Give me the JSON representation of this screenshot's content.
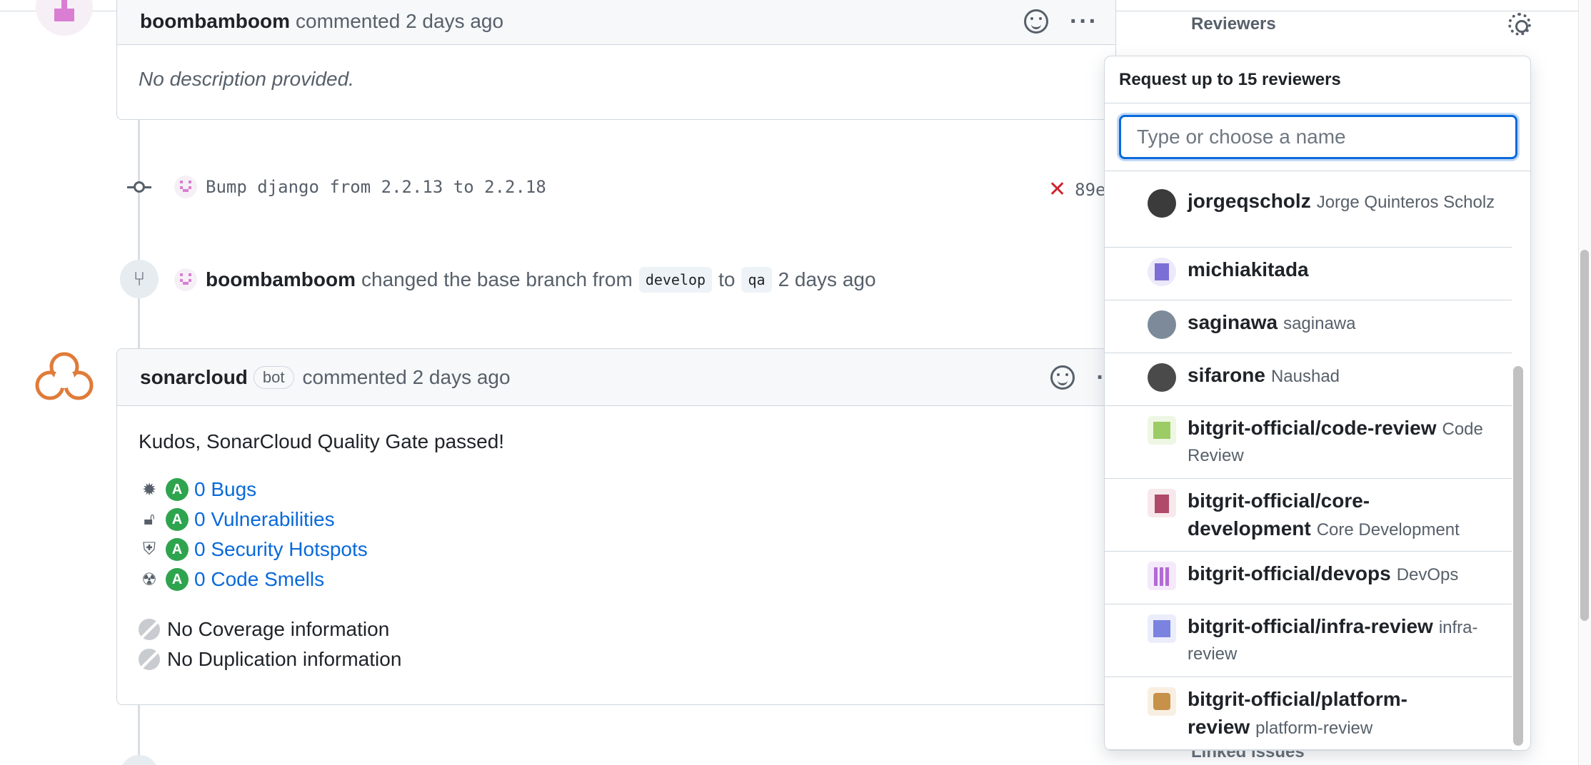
{
  "comment1": {
    "author": "boombamboom",
    "action": "commented 2 days ago",
    "body": "No description provided."
  },
  "commit": {
    "message": "Bump django from 2.2.13 to 2.2.18",
    "sha": "89e",
    "status_icon": "x-icon"
  },
  "base_change": {
    "author": "boombamboom",
    "text": "changed the base branch from",
    "from": "develop",
    "to_word": "to",
    "to": "qa",
    "time": "2 days ago"
  },
  "comment2": {
    "author": "sonarcloud",
    "badge": "bot",
    "action": "commented 2 days ago",
    "kudos": "Kudos, SonarCloud Quality Gate passed!",
    "metrics": [
      {
        "icon": "bug-icon",
        "grade": "A",
        "label": "0 Bugs"
      },
      {
        "icon": "unlock-icon",
        "grade": "A",
        "label": "0 Vulnerabilities"
      },
      {
        "icon": "shield-icon",
        "grade": "A",
        "label": "0 Security Hotspots"
      },
      {
        "icon": "radiation-icon",
        "grade": "A",
        "label": "0 Code Smells"
      }
    ],
    "infos": [
      {
        "icon": "no-data-icon",
        "label": "No Coverage information"
      },
      {
        "icon": "no-data-icon",
        "label": "No Duplication information"
      }
    ]
  },
  "sidebar": {
    "reviewers_title": "Reviewers",
    "linked_issues": "Linked issues"
  },
  "popover": {
    "title": "Request up to 15 reviewers",
    "search_placeholder": "Type or choose a name",
    "items": [
      {
        "login": "jorgeqscholz",
        "name": "Jorge Quinteros Scholz",
        "avatar_color": "#3b3b3b"
      },
      {
        "login": "michiakitada",
        "name": "",
        "avatar_color": "#7b6fd6"
      },
      {
        "login": "saginawa",
        "name": "saginawa",
        "avatar_color": "#7d8a9a"
      },
      {
        "login": "sifarone",
        "name": "Naushad",
        "avatar_color": "#4a4a4a"
      },
      {
        "login": "bitgrit-official/code-review",
        "name": "Code Review",
        "avatar_color": "#9ccc65"
      },
      {
        "login": "bitgrit-official/core-development",
        "name": "Core Development",
        "avatar_color": "#b04a6a"
      },
      {
        "login": "bitgrit-official/devops",
        "name": "DevOps",
        "avatar_color": "#b36ad6"
      },
      {
        "login": "bitgrit-official/infra-review",
        "name": "infra-review",
        "avatar_color": "#7b82e0"
      },
      {
        "login": "bitgrit-official/platform-review",
        "name": "platform-review",
        "avatar_color": "#c8914a"
      }
    ]
  }
}
